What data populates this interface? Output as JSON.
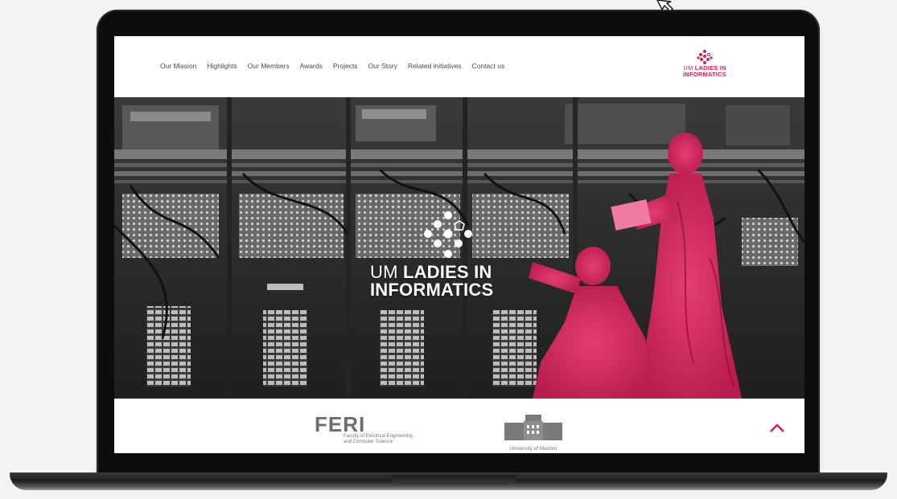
{
  "nav": {
    "links": [
      "Our Mission",
      "Highlights",
      "Our Members",
      "Awards",
      "Projects",
      "Our Story",
      "Related initiatives",
      "Contact us"
    ],
    "logo": {
      "prefix": "UM",
      "line1": "LADIES IN",
      "line2": "INFORMATICS"
    }
  },
  "hero": {
    "title_prefix": "UM",
    "title_line1": "LADIES IN",
    "title_line2": "INFORMATICS"
  },
  "footer": {
    "feri_word": "FERI",
    "feri_sub1": "Faculty of Electrical Engineering",
    "feri_sub2": "and Computer Science",
    "um_caption": "University of Maribor"
  },
  "colors": {
    "accent": "#d41e56",
    "nav_text": "#4a4a4a"
  },
  "icons": {
    "scroll_up": "chevron-up-icon",
    "cursor": "mouse-pointer-icon"
  }
}
